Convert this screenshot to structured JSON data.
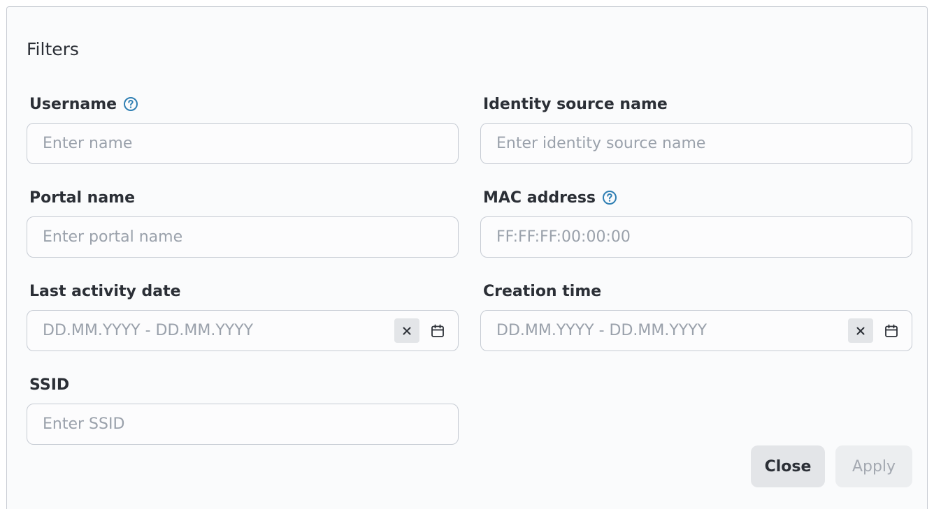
{
  "panel": {
    "title": "Filters"
  },
  "fields": {
    "username": {
      "label": "Username",
      "placeholder": "Enter name"
    },
    "identity_source": {
      "label": "Identity source name",
      "placeholder": "Enter identity source name"
    },
    "portal_name": {
      "label": "Portal name",
      "placeholder": "Enter portal name"
    },
    "mac_address": {
      "label": "MAC address",
      "placeholder": "FF:FF:FF:00:00:00"
    },
    "last_activity": {
      "label": "Last activity date",
      "placeholder": "DD.MM.YYYY - DD.MM.YYYY"
    },
    "creation_time": {
      "label": "Creation time",
      "placeholder": "DD.MM.YYYY - DD.MM.YYYY"
    },
    "ssid": {
      "label": "SSID",
      "placeholder": "Enter SSID"
    }
  },
  "actions": {
    "close_label": "Close",
    "apply_label": "Apply"
  },
  "icons": {
    "help": "question-circle-icon",
    "clear": "close-x-icon",
    "calendar": "calendar-icon"
  },
  "colors": {
    "help_icon": "#2f7fb3",
    "text": "#2b2f36",
    "placeholder": "#9aa1ab",
    "border": "#c6cbd3",
    "button_bg": "#e3e5e8",
    "disabled_text": "#a4a9b1"
  }
}
